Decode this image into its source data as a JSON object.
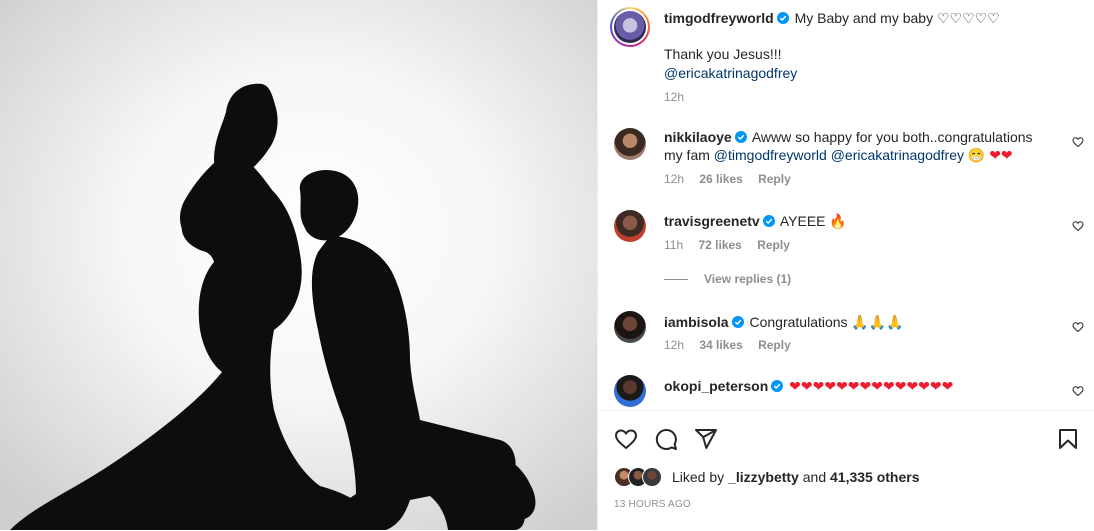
{
  "post": {
    "author": "timgodfreyworld",
    "caption_line1": "My Baby and my baby ♡♡♡♡♡",
    "caption_line2": "Thank you Jesus!!!",
    "caption_mention": "@ericakatrinagodfrey",
    "time_ago": "12h"
  },
  "comments": [
    {
      "username": "nikkilaoye",
      "text": "Awww so happy for you both..congratulations my fam",
      "mention1": "@timgodfreyworld",
      "mention2": "@ericakatrinagodfrey",
      "emoji": "😁",
      "time": "12h",
      "likes": "26 likes",
      "reply": "Reply"
    },
    {
      "username": "travisgreenetv",
      "text": "AYEEE 🔥",
      "time": "11h",
      "likes": "72 likes",
      "reply": "Reply",
      "view_replies": "View replies (1)"
    },
    {
      "username": "iambisola",
      "text": "Congratulations 🙏🙏🙏",
      "time": "12h",
      "likes": "34 likes",
      "reply": "Reply"
    },
    {
      "username": "okopi_peterson",
      "text": "❤❤❤❤❤❤❤❤❤❤❤❤❤❤"
    }
  ],
  "footer": {
    "liked_by_prefix": "Liked by",
    "liked_by_user": "_lizzybetty",
    "liked_by_and": "and",
    "liked_by_count": "41,335 others",
    "timestamp": "13 HOURS AGO"
  },
  "icons": [
    "heart-icon",
    "comment-icon",
    "share-icon",
    "bookmark-icon",
    "verified-icon"
  ],
  "colors": {
    "verified": "#0095f6",
    "mention": "#00376b",
    "meta": "#8e8e8e",
    "heart": "#ed1c2e"
  }
}
